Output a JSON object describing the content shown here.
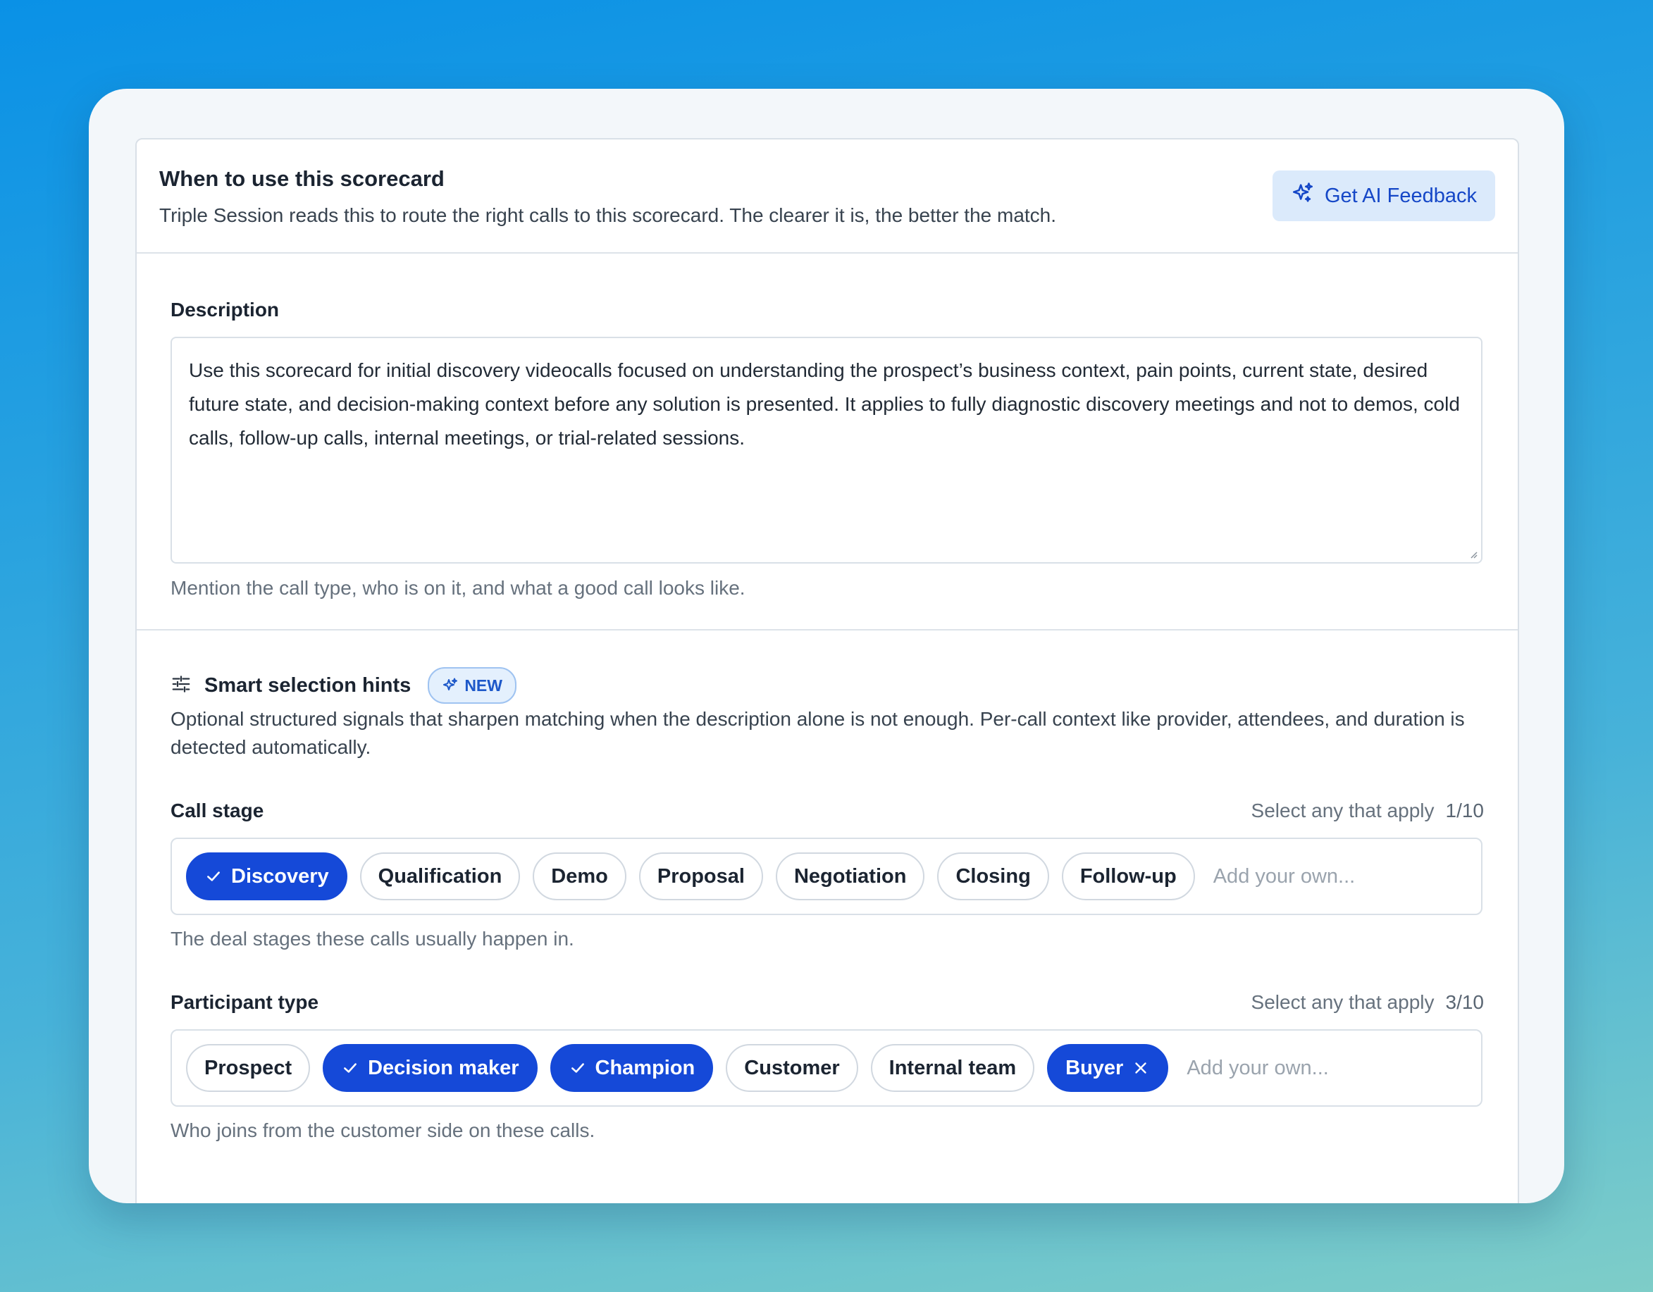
{
  "header": {
    "title": "When to use this scorecard",
    "subtitle": "Triple Session reads this to route the right calls to this scorecard. The clearer it is, the better the match.",
    "ai_button_label": "Get AI Feedback"
  },
  "description": {
    "label": "Description",
    "value": "Use this scorecard for initial discovery videocalls focused on understanding the prospect’s business context, pain points, current state, desired future state, and decision-making context before any solution is presented. It applies to fully diagnostic discovery meetings and not to demos, cold calls, follow-up calls, internal meetings, or trial-related sessions.",
    "helper": "Mention the call type, who is on it, and what a good call looks like."
  },
  "hints": {
    "title": "Smart selection hints",
    "badge": "NEW",
    "description": "Optional structured signals that sharpen matching when the description alone is not enough. Per-call context like provider, attendees, and duration is detected automatically."
  },
  "call_stage": {
    "label": "Call stage",
    "select_text": "Select any that apply",
    "count": "1/10",
    "chips": [
      {
        "label": "Discovery",
        "selected": true
      },
      {
        "label": "Qualification",
        "selected": false
      },
      {
        "label": "Demo",
        "selected": false
      },
      {
        "label": "Proposal",
        "selected": false
      },
      {
        "label": "Negotiation",
        "selected": false
      },
      {
        "label": "Closing",
        "selected": false
      },
      {
        "label": "Follow-up",
        "selected": false
      }
    ],
    "placeholder": "Add your own...",
    "helper": "The deal stages these calls usually happen in."
  },
  "participant_type": {
    "label": "Participant type",
    "select_text": "Select any that apply",
    "count": "3/10",
    "chips": [
      {
        "label": "Prospect",
        "selected": false
      },
      {
        "label": "Decision maker",
        "selected": true
      },
      {
        "label": "Champion",
        "selected": true
      },
      {
        "label": "Customer",
        "selected": false
      },
      {
        "label": "Internal team",
        "selected": false
      },
      {
        "label": "Buyer",
        "selected": true,
        "custom": true
      }
    ],
    "placeholder": "Add your own...",
    "helper": "Who joins from the customer side on these calls."
  },
  "colors": {
    "accent": "#1549d8",
    "badge_bg": "#e4f0fd",
    "ai_button_bg": "#dbeafb"
  },
  "icons": {
    "ai_button": "sparkles-icon",
    "hints": "sliders-icon",
    "selected_chip": "check-icon",
    "custom_chip_remove": "close-icon"
  }
}
